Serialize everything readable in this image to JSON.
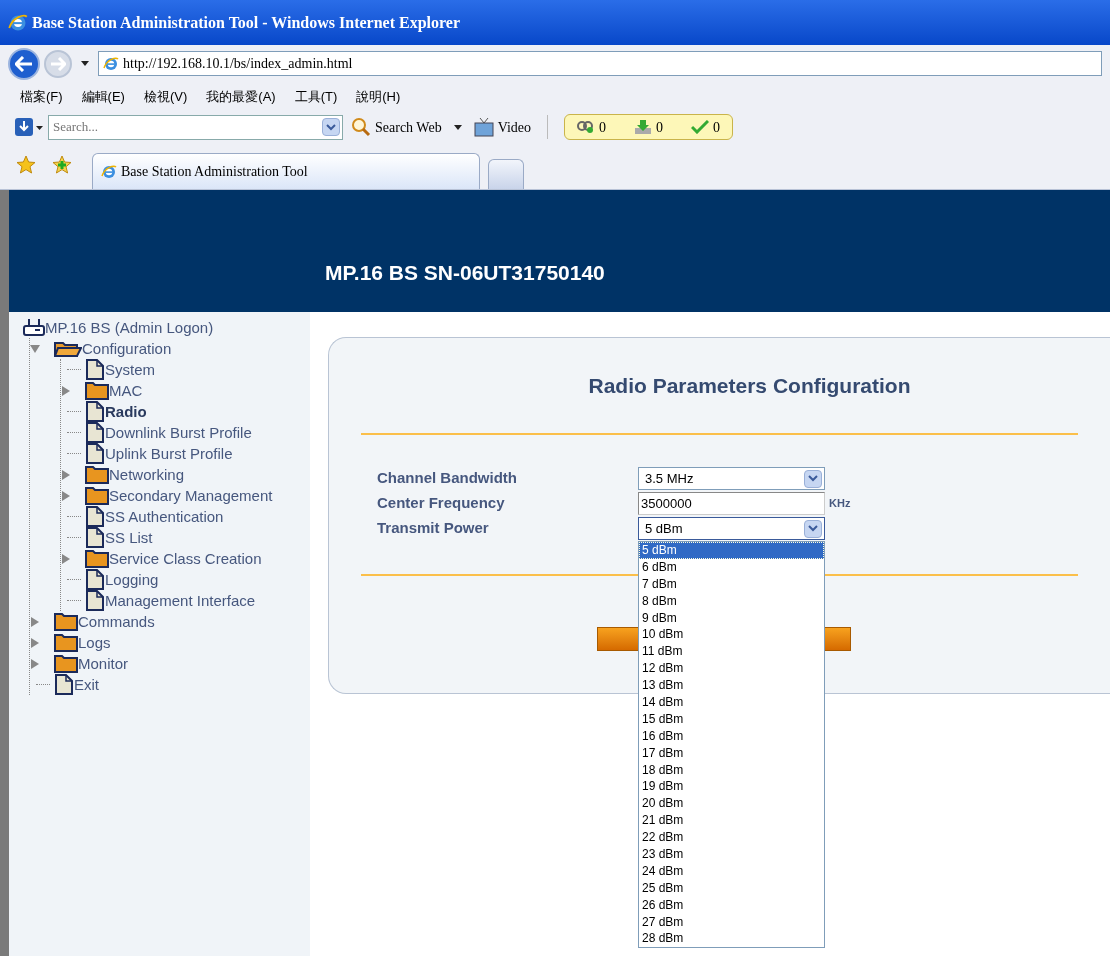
{
  "window": {
    "title": "Base Station Administration Tool - Windows Internet Explorer"
  },
  "address_bar": {
    "value": "http://192.168.10.1/bs/index_admin.html"
  },
  "menu_bar": [
    "檔案(F)",
    "編輯(E)",
    "檢視(V)",
    "我的最愛(A)",
    "工具(T)",
    "說明(H)"
  ],
  "search_toolbar": {
    "placeholder": "Search...",
    "search_button": "Search Web",
    "video_button": "Video",
    "counters": [
      "0",
      "0",
      "0"
    ]
  },
  "tabs": [
    {
      "label": "Base Station Administration Tool",
      "selected": true
    }
  ],
  "header": {
    "title": "MP.16 BS SN-06UT31750140"
  },
  "tree": {
    "label": "MP.16 BS (Admin Logon)",
    "kind": "device",
    "children": [
      {
        "label": "Configuration",
        "kind": "folder",
        "expanded": true,
        "selected": false,
        "children": [
          {
            "label": "System",
            "kind": "page",
            "selected": false
          },
          {
            "label": "MAC",
            "kind": "folder",
            "expanded": false,
            "selected": false
          },
          {
            "label": "Radio",
            "kind": "page",
            "selected": true
          },
          {
            "label": "Downlink Burst Profile",
            "kind": "page",
            "selected": false
          },
          {
            "label": "Uplink Burst Profile",
            "kind": "page",
            "selected": false
          },
          {
            "label": "Networking",
            "kind": "folder",
            "expanded": false,
            "selected": false
          },
          {
            "label": "Secondary Management",
            "kind": "folder",
            "expanded": false,
            "selected": false
          },
          {
            "label": "SS Authentication",
            "kind": "page",
            "selected": false
          },
          {
            "label": "SS List",
            "kind": "page",
            "selected": false
          },
          {
            "label": "Service Class Creation",
            "kind": "folder",
            "expanded": false,
            "selected": false
          },
          {
            "label": "Logging",
            "kind": "page",
            "selected": false
          },
          {
            "label": "Management Interface",
            "kind": "page",
            "selected": false
          }
        ]
      },
      {
        "label": "Commands",
        "kind": "folder",
        "expanded": false,
        "selected": false
      },
      {
        "label": "Logs",
        "kind": "folder",
        "expanded": false,
        "selected": false
      },
      {
        "label": "Monitor",
        "kind": "folder",
        "expanded": false,
        "selected": false
      },
      {
        "label": "Exit",
        "kind": "page",
        "selected": false
      }
    ]
  },
  "form": {
    "title": "Radio Parameters Configuration",
    "fields": [
      {
        "label": "Channel Bandwidth",
        "kind": "select",
        "value": "3.5 MHz"
      },
      {
        "label": "Center Frequency",
        "kind": "text",
        "value": "3500000",
        "unit": "KHz"
      },
      {
        "label": "Transmit Power",
        "kind": "select",
        "value": "5 dBm",
        "expanded": true,
        "options": [
          {
            "label": "5 dBm",
            "selected": true
          },
          {
            "label": "6 dBm",
            "selected": false
          },
          {
            "label": "7 dBm",
            "selected": false
          },
          {
            "label": "8 dBm",
            "selected": false
          },
          {
            "label": "9 dBm",
            "selected": false
          },
          {
            "label": "10 dBm",
            "selected": false
          },
          {
            "label": "11 dBm",
            "selected": false
          },
          {
            "label": "12 dBm",
            "selected": false
          },
          {
            "label": "13 dBm",
            "selected": false
          },
          {
            "label": "14 dBm",
            "selected": false
          },
          {
            "label": "15 dBm",
            "selected": false
          },
          {
            "label": "16 dBm",
            "selected": false
          },
          {
            "label": "17 dBm",
            "selected": false
          },
          {
            "label": "18 dBm",
            "selected": false
          },
          {
            "label": "19 dBm",
            "selected": false
          },
          {
            "label": "20 dBm",
            "selected": false
          },
          {
            "label": "21 dBm",
            "selected": false
          },
          {
            "label": "22 dBm",
            "selected": false
          },
          {
            "label": "23 dBm",
            "selected": false
          },
          {
            "label": "24 dBm",
            "selected": false
          },
          {
            "label": "25 dBm",
            "selected": false
          },
          {
            "label": "26 dBm",
            "selected": false
          },
          {
            "label": "27 dBm",
            "selected": false
          },
          {
            "label": "28 dBm",
            "selected": false
          }
        ]
      }
    ]
  }
}
